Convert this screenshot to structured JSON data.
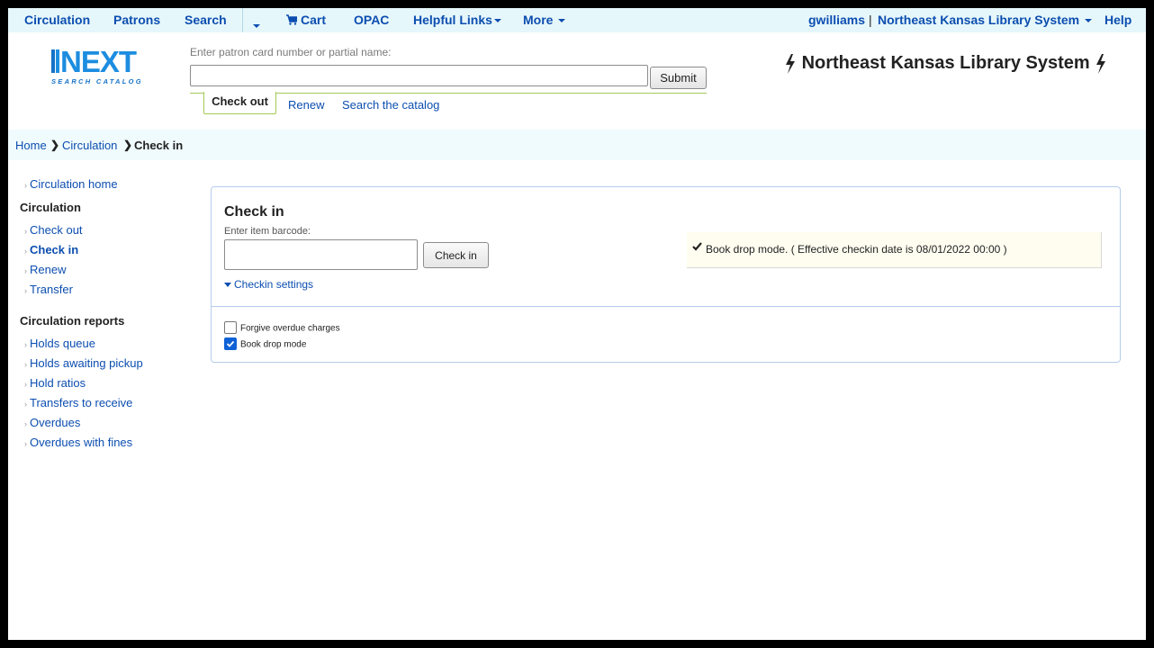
{
  "topnav": {
    "circulation": "Circulation",
    "patrons": "Patrons",
    "search": "Search",
    "cart": "Cart",
    "opac": "OPAC",
    "helpful_links": "Helpful Links",
    "more": "More",
    "user": "gwilliams",
    "separator": "|",
    "library": "Northeast Kansas Library System",
    "help": "Help"
  },
  "header": {
    "logo_text": "NEXT",
    "logo_sub": "SEARCH CATALOG",
    "patron_label": "Enter patron card number or partial name:",
    "patron_value": "",
    "submit": "Submit",
    "tabs": [
      "Check out",
      "Renew",
      "Search the catalog"
    ],
    "library_name": "Northeast Kansas Library System"
  },
  "breadcrumb": {
    "home": "Home",
    "circulation": "Circulation",
    "current": "Check in"
  },
  "sidebar": {
    "home_link": "Circulation home",
    "section1_title": "Circulation",
    "section1_items": [
      "Check out",
      "Check in",
      "Renew",
      "Transfer"
    ],
    "section2_title": "Circulation reports",
    "section2_items": [
      "Holds queue",
      "Holds awaiting pickup",
      "Hold ratios",
      "Transfers to receive",
      "Overdues",
      "Overdues with fines"
    ]
  },
  "checkin": {
    "title": "Check in",
    "barcode_label": "Enter item barcode:",
    "barcode_value": "",
    "button": "Check in",
    "settings_toggle": "Checkin settings",
    "status": "Book drop mode. ( Effective checkin date is 08/01/2022 00:00 )",
    "options": [
      {
        "label": "Forgive overdue charges",
        "checked": false
      },
      {
        "label": "Book drop mode",
        "checked": true
      }
    ]
  },
  "colors": {
    "link": "#0c4eb0",
    "nav_bg": "#e6f7fb",
    "tab_border": "#a5c85a",
    "panel_border": "#b6ccec",
    "status_bg": "#fffdf0"
  }
}
